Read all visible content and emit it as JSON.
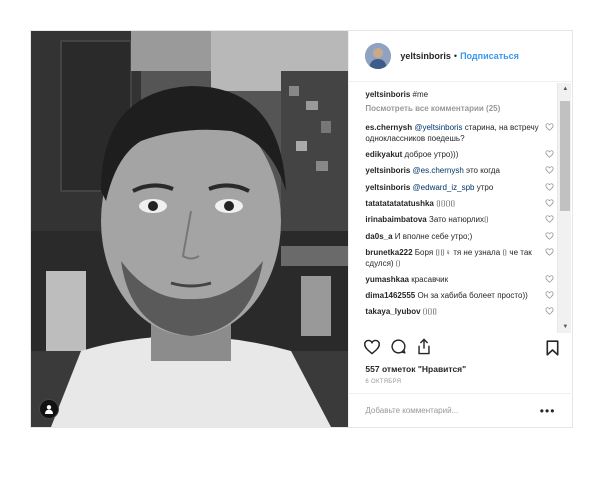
{
  "header": {
    "username": "yeltsinboris",
    "dot": "•",
    "follow_label": "Подписаться"
  },
  "caption": {
    "username": "yeltsinboris",
    "text": "#me"
  },
  "load_more_label": "Посмотреть все комментарии (25)",
  "comments": [
    {
      "user": "es.chernysh",
      "mention": "@yeltsinboris",
      "text": " старина, на встречу одноклассников поедешь?"
    },
    {
      "user": "edikyakut",
      "mention": "",
      "text": "доброе утро)))"
    },
    {
      "user": "yeltsinboris",
      "mention": "@es.chernysh",
      "text": " это когда"
    },
    {
      "user": "yeltsinboris",
      "mention": "@edward_iz_spb",
      "text": " утро"
    },
    {
      "user": "tatatatatatatushka",
      "mention": "",
      "text": "⌷⌷⌷⌷"
    },
    {
      "user": "irinabaimbatova",
      "mention": "",
      "text": "Зато натюрлих⌷"
    },
    {
      "user": "da0s_a",
      "mention": "",
      "text": "И вполне себе утро;)"
    },
    {
      "user": "brunetka222",
      "mention": "",
      "text": "Боря ⌷⌷♀ тя не узнала ⌷ че так сдулся) ⌷"
    },
    {
      "user": "yumashkaa",
      "mention": "",
      "text": "красавчик"
    },
    {
      "user": "dima1462555",
      "mention": "",
      "text": "Он за хабиба болеет просто))"
    },
    {
      "user": "takaya_lyubov",
      "mention": "",
      "text": "⌷⌷⌷"
    }
  ],
  "likes_text": "557 отметок \"Нравится\"",
  "date_text": "6 ОКТЯБРЯ",
  "add_comment": {
    "placeholder": "Добавьте комментарий...",
    "value": ""
  },
  "more_label": "•••",
  "icons": {
    "like": "heart-icon",
    "comment": "comment-bubble-icon",
    "share": "share-upload-icon",
    "save": "bookmark-icon",
    "tag": "person-tag-icon",
    "scroll_up": "scroll-up-arrow-icon",
    "scroll_down": "scroll-down-arrow-icon"
  },
  "colors": {
    "link": "#3897f0",
    "mention": "#003569",
    "muted": "#999999",
    "text": "#262626"
  }
}
